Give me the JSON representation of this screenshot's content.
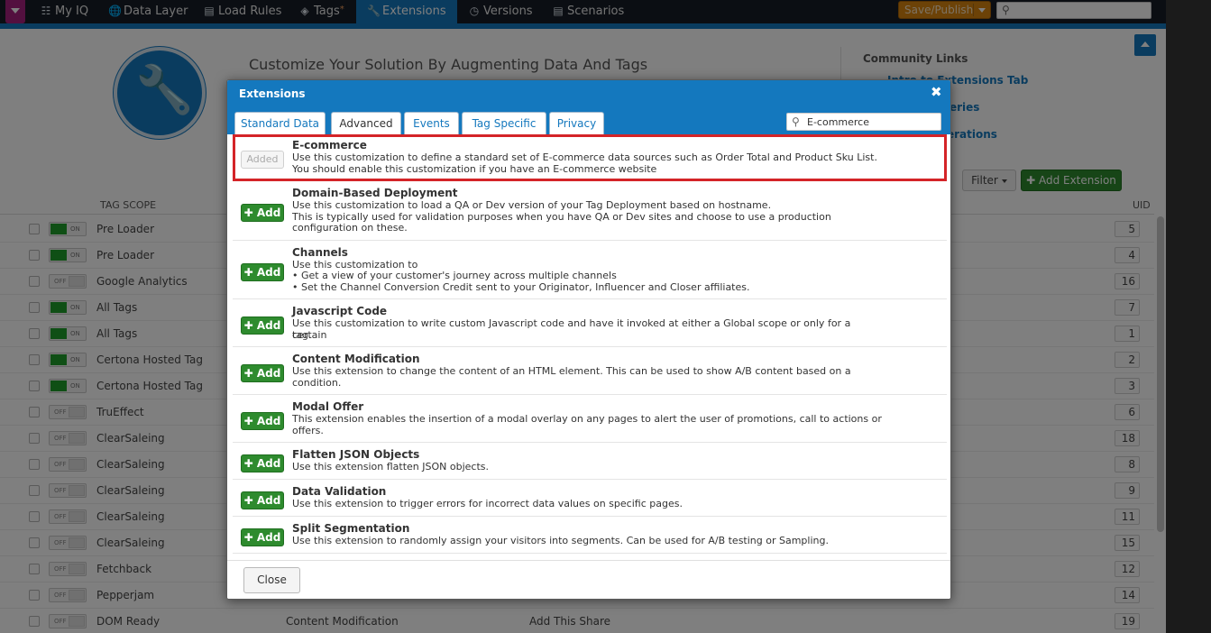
{
  "nav": {
    "items": [
      {
        "label": "My IQ",
        "icon": "sitemap-icon"
      },
      {
        "label": "Data Layer",
        "icon": "globe-icon"
      },
      {
        "label": "Load Rules",
        "icon": "book-icon"
      },
      {
        "label": "Tags",
        "icon": "tag-icon"
      },
      {
        "label": "Extensions",
        "icon": "wrench-icon"
      },
      {
        "label": "Versions",
        "icon": "clock-icon"
      },
      {
        "label": "Scenarios",
        "icon": "film-icon"
      }
    ],
    "tags_marker": "*",
    "save_publish": "Save/Publish",
    "search_value": ""
  },
  "header": {
    "title": "Customize Your Solution By Augmenting Data And Tags",
    "community_title": "Community Links",
    "links": [
      "Intro to Extensions Tab",
      "eries",
      "erations"
    ],
    "filter": "Filter",
    "add_extension": "Add Extension"
  },
  "table": {
    "col_scope": "TAG SCOPE",
    "col_uid": "UID",
    "rows": [
      {
        "on": true,
        "toggle": "ON",
        "name": "Pre Loader",
        "c2": "",
        "c3": "",
        "uid": "5"
      },
      {
        "on": true,
        "toggle": "ON",
        "name": "Pre Loader",
        "c2": "",
        "c3": "",
        "uid": "4"
      },
      {
        "on": false,
        "toggle": "OFF",
        "name": "Google Analytics",
        "c2": "",
        "c3": "",
        "uid": "16"
      },
      {
        "on": true,
        "toggle": "ON",
        "name": "All Tags",
        "c2": "",
        "c3": "",
        "uid": "7"
      },
      {
        "on": true,
        "toggle": "ON",
        "name": "All Tags",
        "c2": "",
        "c3": "",
        "uid": "1"
      },
      {
        "on": true,
        "toggle": "ON",
        "name": "Certona Hosted Tag",
        "c2": "",
        "c3": "",
        "uid": "2"
      },
      {
        "on": true,
        "toggle": "ON",
        "name": "Certona Hosted Tag",
        "c2": "",
        "c3": "",
        "uid": "3"
      },
      {
        "on": false,
        "toggle": "OFF",
        "name": "TruEffect",
        "c2": "",
        "c3": "",
        "uid": "6"
      },
      {
        "on": false,
        "toggle": "OFF",
        "name": "ClearSaleing",
        "c2": "",
        "c3": "",
        "uid": "18"
      },
      {
        "on": false,
        "toggle": "OFF",
        "name": "ClearSaleing",
        "c2": "",
        "c3": "",
        "uid": "8"
      },
      {
        "on": false,
        "toggle": "OFF",
        "name": "ClearSaleing",
        "c2": "",
        "c3": "",
        "uid": "9"
      },
      {
        "on": false,
        "toggle": "OFF",
        "name": "ClearSaleing",
        "c2": "",
        "c3": "",
        "uid": "11"
      },
      {
        "on": false,
        "toggle": "OFF",
        "name": "ClearSaleing",
        "c2": "",
        "c3": "",
        "uid": "15"
      },
      {
        "on": false,
        "toggle": "OFF",
        "name": "Fetchback",
        "c2": "",
        "c3": "",
        "uid": "12"
      },
      {
        "on": false,
        "toggle": "OFF",
        "name": "Pepperjam",
        "c2": "",
        "c3": "",
        "uid": "14"
      },
      {
        "on": false,
        "toggle": "OFF",
        "name": "DOM Ready",
        "c2": "Content Modification",
        "c3": "Add This Share",
        "uid": "19"
      }
    ]
  },
  "modal": {
    "title": "Extensions",
    "close_x": "✖",
    "tabs": [
      "Standard Data",
      "Advanced",
      "Events",
      "Tag Specific",
      "Privacy"
    ],
    "active_tab": "Advanced",
    "search_value": "E-commerce",
    "add_label": "Add",
    "added_label": "Added",
    "extensions": [
      {
        "name": "E-commerce",
        "status": "added",
        "desc": [
          "Use this customization to define a standard set of E-commerce data sources such as Order Total and Product Sku List.",
          "You should enable this customization if you have an E-commerce website"
        ]
      },
      {
        "name": "Domain-Based Deployment",
        "status": "add",
        "desc": [
          "Use this customization to load a QA or Dev version of your Tag Deployment based on hostname.",
          "This is typically used for validation purposes when you have QA or Dev sites and choose to use a production",
          "configuration on these."
        ]
      },
      {
        "name": "Channels",
        "status": "add",
        "desc": [
          "Use this customization to",
          "• Get a view of your customer's journey across multiple channels",
          "• Set the Channel Conversion Credit sent to your Originator, Influencer and Closer affiliates."
        ]
      },
      {
        "name": "Javascript Code",
        "status": "add",
        "desc": [
          "Use this customization to write custom Javascript code and have it invoked at either a Global scope or only for a certain",
          "tag."
        ]
      },
      {
        "name": "Content Modification",
        "status": "add",
        "desc": [
          "Use this extension to change the content of an HTML element. This can be used to show A/B content based on a",
          "condition."
        ]
      },
      {
        "name": "Modal Offer",
        "status": "add",
        "desc": [
          "This extension enables the insertion of a modal overlay on any pages to alert the user of promotions, call to actions or",
          "offers."
        ]
      },
      {
        "name": "Flatten JSON Objects",
        "status": "add",
        "desc": [
          "Use this extension flatten JSON objects."
        ]
      },
      {
        "name": "Data Validation",
        "status": "add",
        "desc": [
          "Use this extension to trigger errors for incorrect data values on specific pages."
        ]
      },
      {
        "name": "Split Segmentation",
        "status": "add",
        "desc": [
          "Use this extension to randomly assign your visitors into segments. Can be used for A/B testing or Sampling."
        ]
      }
    ],
    "close_button": "Close"
  }
}
